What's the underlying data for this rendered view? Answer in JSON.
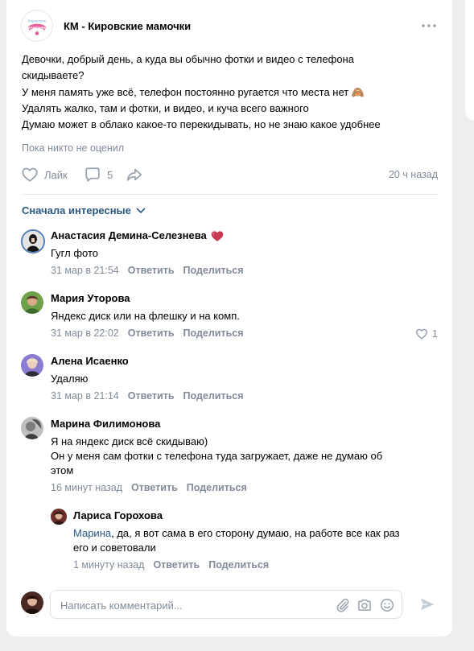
{
  "post": {
    "group_name": "КМ - Кировские мамочки",
    "group_logo_text": "Кировские МАМОЧКИ",
    "text_lines": [
      "Девочки, добрый день, а куда вы обычно фотки и видео с телефона",
      "скидываете?",
      "У меня память уже всё, телефон постоянно ругается что места нет 🙈",
      "Удалять жалко, там и фотки, и видео, и куча всего важного",
      "Думаю может в облако какое-то перекидывать, но не знаю какое удобнее"
    ],
    "no_likes": "Пока никто не оценил",
    "like_label": "Лайк",
    "comments_count": "5",
    "time": "20 ч назад"
  },
  "sort_label": "Сначала интересные",
  "comments": [
    {
      "author": "Анастасия Демина-Селезнева",
      "text_lines": [
        "Гугл фото"
      ],
      "date": "31 мар в 21:54",
      "reply": "Ответить",
      "share": "Поделиться"
    },
    {
      "author": "Мария Уторова",
      "text_lines": [
        "Яндекс диск или на флешку и на комп."
      ],
      "date": "31 мар в 22:02",
      "reply": "Ответить",
      "share": "Поделиться",
      "likes": "1"
    },
    {
      "author": "Алена Исаенко",
      "text_lines": [
        "Удаляю"
      ],
      "date": "31 мар в 21:14",
      "reply": "Ответить",
      "share": "Поделиться"
    },
    {
      "author": "Марина Филимонова",
      "text_lines": [
        "Я на яндекс диск всё скидываю)",
        "Он у меня сам фотки с телефона туда загружает, даже не думаю об",
        "этом"
      ],
      "date": "16 минут назад",
      "reply": "Ответить",
      "share": "Поделиться"
    },
    {
      "author": "Лариса Горохова",
      "mention": "Марина",
      "text_line1_rest": ", да, я вот сама в его сторону думаю, на работе все как раз",
      "text_line2": "его и советовали",
      "date": "1 минуту назад",
      "reply": "Ответить",
      "share": "Поделиться"
    }
  ],
  "composer": {
    "placeholder": "Написать комментарий..."
  },
  "colors": {
    "link": "#2a5885",
    "secondary": "#818c99",
    "heart": "#d64b62"
  }
}
